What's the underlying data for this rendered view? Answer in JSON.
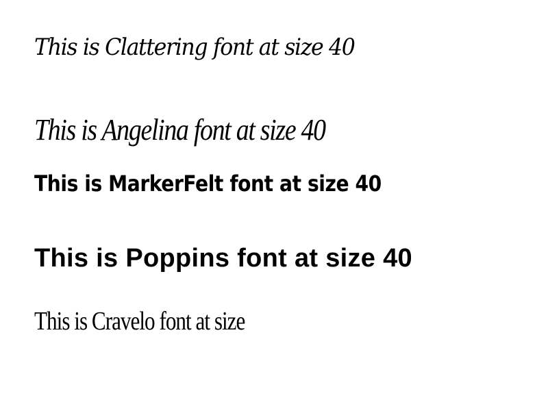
{
  "samples": [
    {
      "text": "This is Clattering font at size 40"
    },
    {
      "text": "This is Angelina font at size 40"
    },
    {
      "text": "This is MarkerFelt font at size 40"
    },
    {
      "text": "This is Poppins font at size 40"
    },
    {
      "text": "This is Cravelo font at size"
    }
  ]
}
